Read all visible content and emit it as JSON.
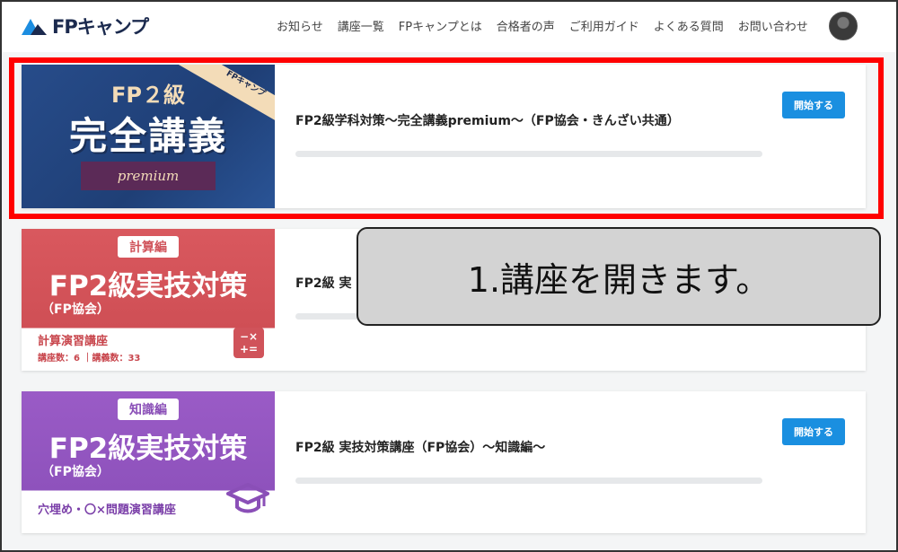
{
  "header": {
    "logo_text": "FPキャンプ",
    "nav": [
      "お知らせ",
      "講座一覧",
      "FPキャンプとは",
      "合格者の声",
      "ご利用ガイド",
      "よくある質問",
      "お問い合わせ"
    ]
  },
  "courses": [
    {
      "title": "FP2級学科対策～完全講義premium～（FP協会・きんざい共通）",
      "button": "開始する",
      "thumb": {
        "logo": "FPキャンプ",
        "line1": "FP２級",
        "line2": "完全講義",
        "ribbon": "premium"
      }
    },
    {
      "title": "FP2級 実",
      "button": "",
      "thumb": {
        "tag": "計算編",
        "big": "FP2級実技対策",
        "sub": "（FP協会）",
        "sub2": "計算演習講座",
        "sub3": "講座数：6 ｜講義数：33",
        "icon": "calculator-icon"
      }
    },
    {
      "title": "FP2級 実技対策講座（FP協会）～知識編～",
      "button": "開始する",
      "thumb": {
        "tag": "知識編",
        "big": "FP2級実技対策",
        "sub": "（FP協会）",
        "sub2": "穴埋め・〇×問題演習講座",
        "icon": "graduation-cap-icon"
      }
    }
  ],
  "callout": "1.講座を開きます。",
  "colors": {
    "accent_button": "#1a8fe0",
    "highlight": "#ff0000",
    "calc_theme": "#d0535a",
    "knowledge_theme": "#8e52bc",
    "premium_theme": "#274c8a"
  }
}
